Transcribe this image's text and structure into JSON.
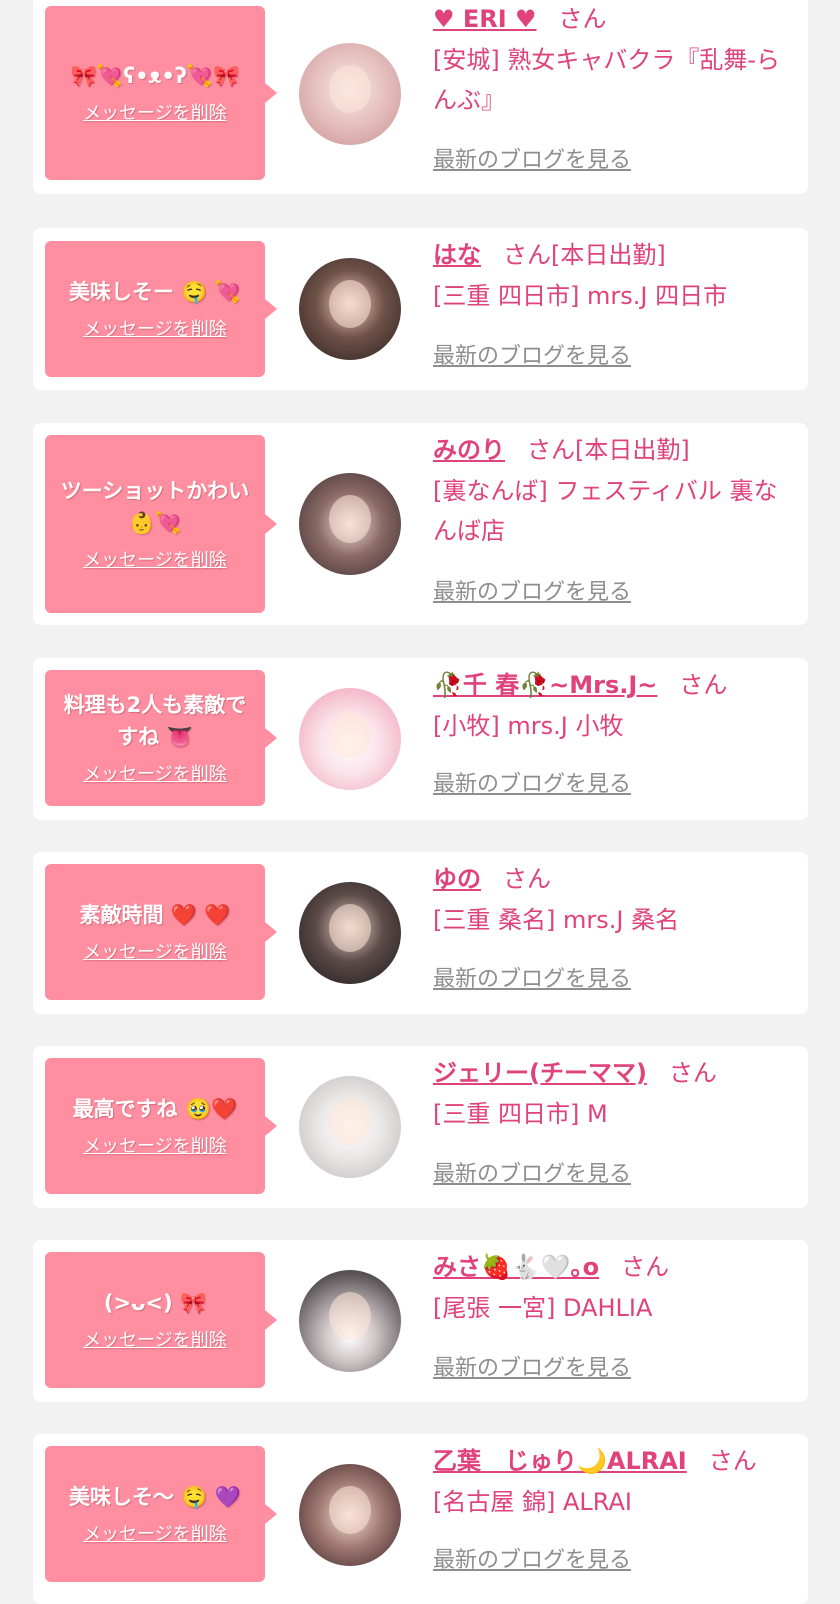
{
  "common": {
    "delete_label": "メッセージを削除",
    "blog_label": "最新のブログを見る",
    "san": "さん"
  },
  "colors": {
    "accent": "#e0427a",
    "bubble": "#ff8fa0",
    "link_gray": "#8e8e8e",
    "background": "#f2f2f2"
  },
  "messages": [
    {
      "message": "🎀💘ʕ•ᴥ•ʔ💘🎀",
      "name": "♥ ERI ♥",
      "status": "",
      "location": "[安城] 熟女キャバクラ『乱舞-らんぶ』"
    },
    {
      "message": "美味しそー 🤤 💘",
      "name": "はな",
      "status": "[本日出勤]",
      "location": "[三重 四日市] mrs.J 四日市"
    },
    {
      "message": "ツーショットかわい 👶💘",
      "name": "みのり",
      "status": "[本日出勤]",
      "location": "[裏なんば] フェスティバル 裏なんば店"
    },
    {
      "message": "料理も2人も素敵ですね 👅",
      "name": "🥀千 春🥀~Mrs.J~",
      "status": "",
      "location": "[小牧] mrs.J 小牧"
    },
    {
      "message": "素敵時間 ❤️ ❤️",
      "name": "ゆの",
      "status": "",
      "location": "[三重 桑名] mrs.J 桑名"
    },
    {
      "message": "最高ですね 🥹❤️",
      "name": "ジェリー(チーママ)",
      "status": "",
      "location": "[三重 四日市] M"
    },
    {
      "message": "(>ᴗ<) 🎀",
      "name": "みさ🍓🐇🤍｡o",
      "status": "",
      "location": "[尾張 一宮] DAHLIA"
    },
    {
      "message": "美味しそ〜 🤤 💜",
      "name": "乙葉　じゅり🌙ALRAI",
      "status": "",
      "location": "[名古屋 錦] ALRAI"
    }
  ]
}
